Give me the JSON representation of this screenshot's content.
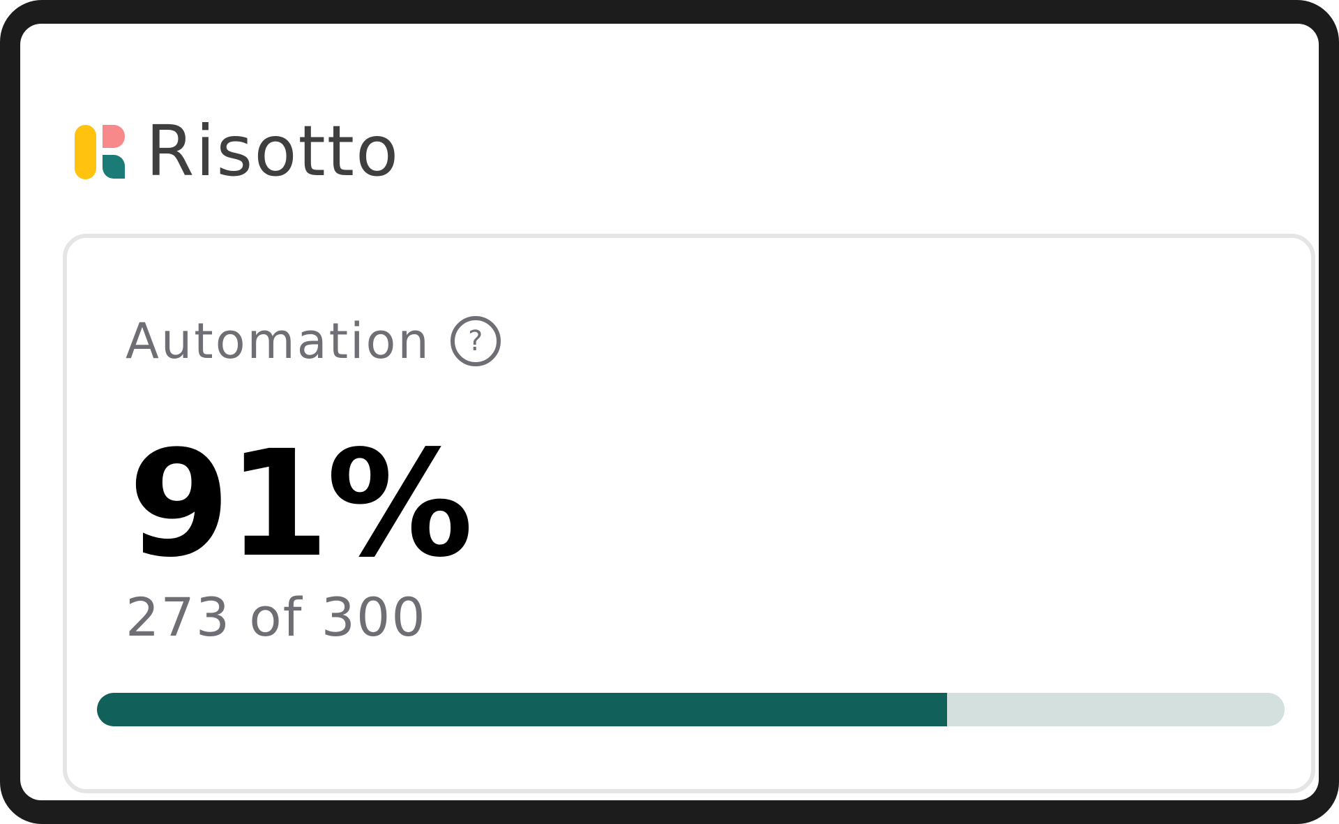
{
  "app": {
    "logo_text": "Risotto",
    "logo_icon": "risotto-logo-icon",
    "brand_colors": {
      "yellow": "#FFC20E",
      "pink": "#F8898B",
      "teal": "#1B7B77"
    }
  },
  "card": {
    "title": "Automation",
    "help_icon": "question-circle-icon",
    "help_glyph": "?",
    "percent": "91%",
    "count_text": "273 of 300",
    "progress": {
      "value": 273,
      "max": 300,
      "fraction": 0.716,
      "fill_color": "#11605A",
      "track_color": "#D3E0DD"
    }
  }
}
